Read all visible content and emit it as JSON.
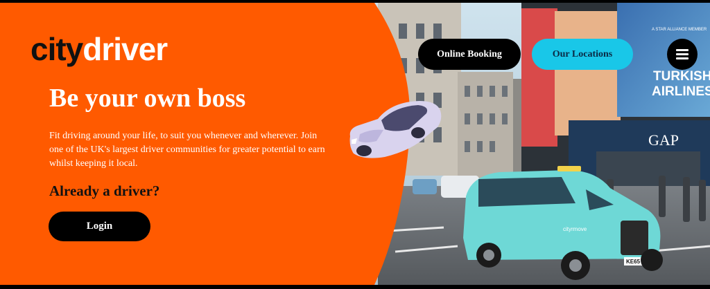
{
  "brand": {
    "city": "city",
    "driver": "driver"
  },
  "hero": {
    "headline": "Be your own boss",
    "body": "Fit driving around your life, to suit you whenever and wherever. Join one of the UK's largest driver communities for greater potential to earn whilst keeping it local.",
    "subhead": "Already a driver?",
    "login_label": "Login"
  },
  "nav": {
    "online_booking": "Online Booking",
    "our_locations": "Our Locations",
    "menu_icon": "hamburger-menu-icon"
  },
  "scene": {
    "sign_top": "A STAR ALLIANCE MEMBER",
    "sign_airline_1": "TURKISH",
    "sign_airline_2": "AIRLINES",
    "shop_sign": "GAP",
    "taxi_livery": "cityrmove",
    "plate": "KE65 KNR"
  },
  "colors": {
    "orange": "#ff5a00",
    "cyan": "#19c7e8",
    "black": "#000000",
    "white": "#ffffff"
  }
}
